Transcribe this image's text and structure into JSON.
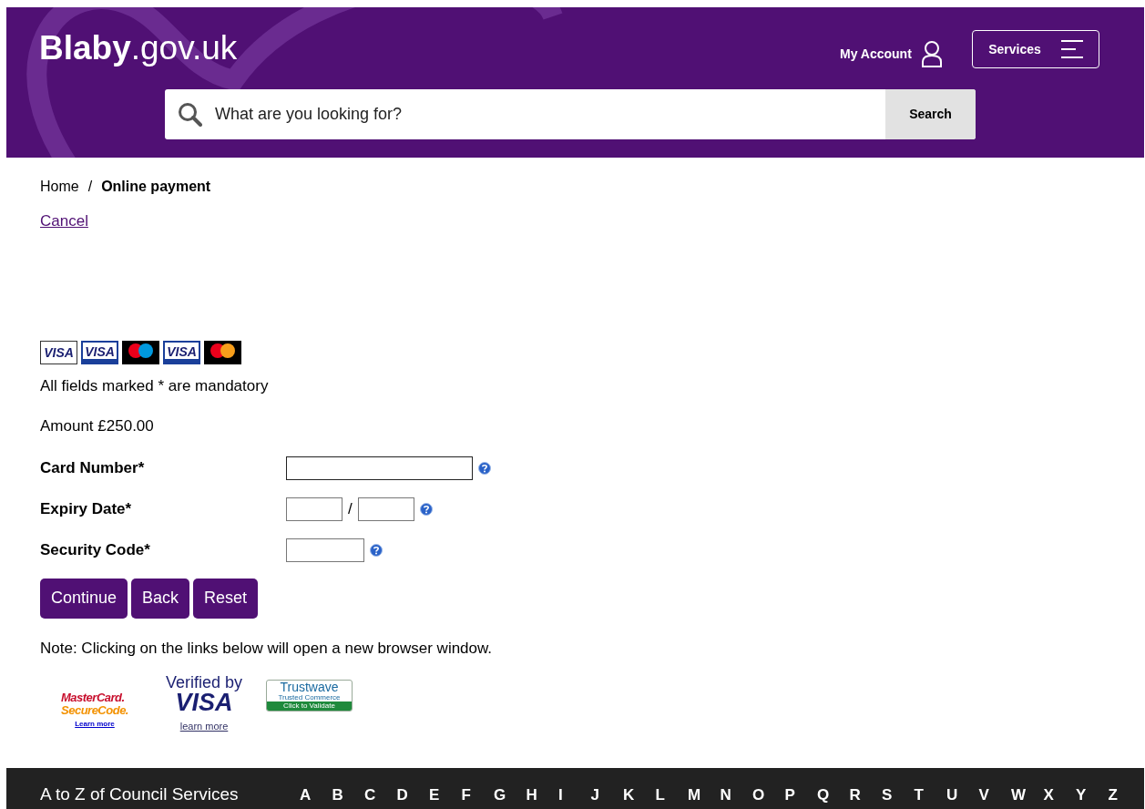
{
  "header": {
    "logo_bold": "Blaby",
    "logo_rest": ".gov.uk",
    "account_link": "My Account",
    "services_button": "Services",
    "search": {
      "placeholder": "What are you looking for?",
      "button": "Search"
    }
  },
  "breadcrumb": [
    {
      "label": "Home",
      "current": false
    },
    {
      "label": "Online payment",
      "current": true,
      "separator": "/"
    }
  ],
  "cancel_link": "Cancel",
  "payment_cards": [
    {
      "kind": "visa",
      "label": "VISA"
    },
    {
      "kind": "visa-band",
      "label": "VISA"
    },
    {
      "kind": "circles",
      "color": "#0099df"
    },
    {
      "kind": "visa-band",
      "label": "VISA"
    },
    {
      "kind": "circles",
      "color": "#f79e1b"
    }
  ],
  "mandatory_note": "All fields marked * are mandatory",
  "amount": "Amount £250.00",
  "fields": [
    {
      "label": "Card Number*",
      "kind": "single"
    },
    {
      "label": "Expiry Date*",
      "kind": "pair",
      "separator": "/"
    },
    {
      "label": "Security Code*",
      "kind": "short"
    }
  ],
  "buttons": [
    "Continue",
    "Back",
    "Reset"
  ],
  "links_note": "Note: Clicking on the links below will open a new browser window.",
  "badges": [
    {
      "kind": "securecode",
      "line1": "MasterCard.",
      "line2": "SecureCode.",
      "link": "Learn more"
    },
    {
      "kind": "vbv",
      "line1": "Verified by",
      "line2": "VISA",
      "link": "learn more"
    },
    {
      "kind": "trustwave",
      "line1": "Trustwave",
      "line2": "Trusted Commerce",
      "line3": "Click to Validate"
    }
  ],
  "footer": {
    "title": "A to Z of Council Services",
    "letters": [
      "A",
      "B",
      "C",
      "D",
      "E",
      "F",
      "G",
      "H",
      "I",
      "J",
      "K",
      "L",
      "M",
      "N",
      "O",
      "P",
      "Q",
      "R",
      "S",
      "T",
      "U",
      "V",
      "W",
      "X",
      "Y",
      "Z"
    ]
  }
}
